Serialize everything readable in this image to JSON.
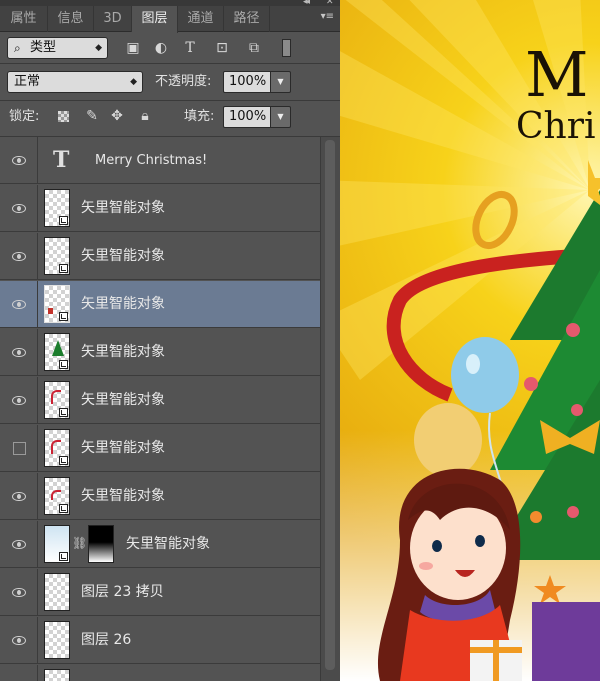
{
  "panel": {
    "tabs": [
      "属性",
      "信息",
      "3D",
      "图层",
      "通道",
      "路径"
    ],
    "active_tab": "图层",
    "panel_menu_icon": "panel-menu-icon",
    "filter": {
      "kind_label": "类型",
      "icons": [
        "image-filter-icon",
        "adjustment-filter-icon",
        "type-filter-icon",
        "shape-filter-icon",
        "smart-object-filter-icon",
        "filter-toggle-icon"
      ]
    },
    "blend_mode": "正常",
    "opacity_label": "不透明度:",
    "opacity_value": "100%",
    "lock_label": "锁定:",
    "lock_icons": [
      "lock-transparent-icon",
      "lock-paint-icon",
      "lock-move-icon",
      "lock-all-icon"
    ],
    "fill_label": "填充:",
    "fill_value": "100%"
  },
  "layers": [
    {
      "name": "Merry    Christmas!",
      "kind": "text",
      "visible": true,
      "selected": false
    },
    {
      "name": "矢里智能对象",
      "kind": "smart",
      "visible": true,
      "selected": false
    },
    {
      "name": "矢里智能对象",
      "kind": "smart",
      "visible": true,
      "selected": false
    },
    {
      "name": "矢里智能对象",
      "kind": "smart",
      "visible": true,
      "selected": true
    },
    {
      "name": "矢里智能对象",
      "kind": "smart",
      "visible": true,
      "selected": false
    },
    {
      "name": "矢里智能对象",
      "kind": "smart",
      "visible": true,
      "selected": false
    },
    {
      "name": "矢里智能对象",
      "kind": "smart",
      "visible": false,
      "selected": false
    },
    {
      "name": "矢里智能对象",
      "kind": "smart",
      "visible": true,
      "selected": false
    },
    {
      "name": "矢里智能对象",
      "kind": "smart-mask",
      "visible": true,
      "selected": false
    },
    {
      "name": "图层 23 拷贝",
      "kind": "pixel",
      "visible": true,
      "selected": false
    },
    {
      "name": "图层 26",
      "kind": "pixel",
      "visible": true,
      "selected": false
    },
    {
      "name": "",
      "kind": "pixel",
      "visible": true,
      "selected": false
    }
  ],
  "canvas": {
    "heading_line1": "M",
    "heading_line2": "Chri"
  },
  "colors": {
    "panel_bg": "#535353",
    "selected_row": "#6b7b93",
    "canvas_yellow": "#f2c20e"
  }
}
